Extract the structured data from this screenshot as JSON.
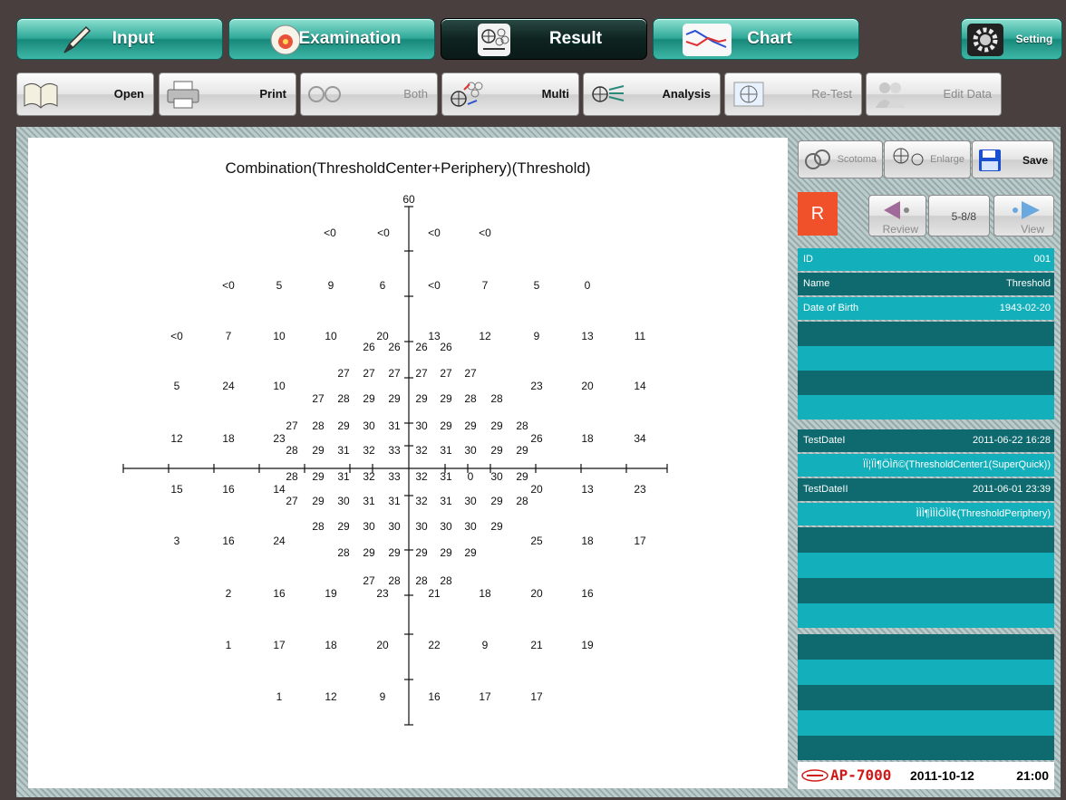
{
  "nav": {
    "tabs": [
      {
        "label": "Input",
        "icon": "pen-icon"
      },
      {
        "label": "Examination",
        "icon": "eye-target-icon"
      },
      {
        "label": "Result",
        "icon": "result-grid-icon"
      },
      {
        "label": "Chart",
        "icon": "chart-line-icon"
      }
    ],
    "setting": "Setting"
  },
  "toolbar": {
    "open": "Open",
    "print": "Print",
    "both": "Both",
    "multi": "Multi",
    "analysis": "Analysis",
    "retest": "Re-Test",
    "edit_data": "Edit Data"
  },
  "side": {
    "scotoma": "Scotoma",
    "enlarge": "Enlarge",
    "save": "Save",
    "eye": "R",
    "review": "Review",
    "page": "5-8/8",
    "view": "View"
  },
  "patient": {
    "id_label": "ID",
    "id_value": "001",
    "name_label": "Name",
    "name_value": "Threshold",
    "dob_label": "Date of Birth",
    "dob_value": "1943-02-20"
  },
  "tests": {
    "t1_label": "TestDateI",
    "t1_value": "2011-06-22 16:28",
    "t1_program": "ÏÏ¦ÏÌ¶ÖÌñ©(ThresholdCenter1(SuperQuick))",
    "t2_label": "TestDateII",
    "t2_value": "2011-06-01 23:39",
    "t2_program": "ÌÌÌ¶ÌÌÌÖÌÌ¢(ThresholdPeriphery)"
  },
  "status": {
    "brand": "AP-7000",
    "date": "2011-10-12",
    "time": "21:00"
  },
  "plot": {
    "title": "Combination(ThresholdCenter+Periphery)(Threshold)",
    "axis_top": "60",
    "values": [
      [
        "<0",
        364,
        257
      ],
      [
        "<0",
        423,
        257
      ],
      [
        "<0",
        479,
        257
      ],
      [
        "<0",
        535,
        257
      ],
      [
        "<0",
        252,
        315
      ],
      [
        "5",
        308,
        315
      ],
      [
        "9",
        365,
        315
      ],
      [
        "6",
        422,
        315
      ],
      [
        "<0",
        479,
        315
      ],
      [
        "7",
        535,
        315
      ],
      [
        "5",
        592,
        315
      ],
      [
        "0",
        648,
        315
      ],
      [
        "<0",
        195,
        371
      ],
      [
        "7",
        252,
        371
      ],
      [
        "10",
        308,
        371
      ],
      [
        "10",
        365,
        371
      ],
      [
        "20",
        422,
        371
      ],
      [
        "13",
        479,
        371
      ],
      [
        "12",
        535,
        371
      ],
      [
        "9",
        592,
        371
      ],
      [
        "13",
        648,
        371
      ],
      [
        "11",
        706,
        371
      ],
      [
        "26",
        407,
        383
      ],
      [
        "26",
        435,
        383
      ],
      [
        "26",
        465,
        383
      ],
      [
        "26",
        492,
        383
      ],
      [
        "27",
        379,
        412
      ],
      [
        "27",
        407,
        412
      ],
      [
        "27",
        435,
        412
      ],
      [
        "27",
        465,
        412
      ],
      [
        "27",
        492,
        412
      ],
      [
        "27",
        519,
        412
      ],
      [
        "5",
        195,
        426
      ],
      [
        "24",
        252,
        426
      ],
      [
        "10",
        308,
        426
      ],
      [
        "23",
        592,
        426
      ],
      [
        "20",
        648,
        426
      ],
      [
        "14",
        706,
        426
      ],
      [
        "27",
        351,
        440
      ],
      [
        "28",
        379,
        440
      ],
      [
        "29",
        407,
        440
      ],
      [
        "29",
        435,
        440
      ],
      [
        "29",
        465,
        440
      ],
      [
        "29",
        492,
        440
      ],
      [
        "28",
        519,
        440
      ],
      [
        "28",
        548,
        440
      ],
      [
        "27",
        322,
        470
      ],
      [
        "28",
        351,
        470
      ],
      [
        "29",
        379,
        470
      ],
      [
        "30",
        407,
        470
      ],
      [
        "31",
        435,
        470
      ],
      [
        "30",
        465,
        470
      ],
      [
        "29",
        492,
        470
      ],
      [
        "29",
        519,
        470
      ],
      [
        "29",
        548,
        470
      ],
      [
        "28",
        576,
        470
      ],
      [
        "12",
        195,
        484
      ],
      [
        "18",
        252,
        484
      ],
      [
        "23",
        308,
        484
      ],
      [
        "26",
        592,
        484
      ],
      [
        "18",
        648,
        484
      ],
      [
        "34",
        706,
        484
      ],
      [
        "28",
        322,
        497
      ],
      [
        "29",
        351,
        497
      ],
      [
        "31",
        379,
        497
      ],
      [
        "32",
        407,
        497
      ],
      [
        "33",
        435,
        497
      ],
      [
        "32",
        465,
        497
      ],
      [
        "31",
        492,
        497
      ],
      [
        "30",
        519,
        497
      ],
      [
        "29",
        548,
        497
      ],
      [
        "29",
        576,
        497
      ],
      [
        "28",
        322,
        526
      ],
      [
        "29",
        351,
        526
      ],
      [
        "31",
        379,
        526
      ],
      [
        "32",
        407,
        526
      ],
      [
        "33",
        435,
        526
      ],
      [
        "32",
        465,
        526
      ],
      [
        "31",
        492,
        526
      ],
      [
        "0",
        519,
        526
      ],
      [
        "30",
        548,
        526
      ],
      [
        "29",
        576,
        526
      ],
      [
        "15",
        195,
        540
      ],
      [
        "16",
        252,
        540
      ],
      [
        "14",
        308,
        540
      ],
      [
        "20",
        592,
        540
      ],
      [
        "13",
        648,
        540
      ],
      [
        "23",
        706,
        540
      ],
      [
        "27",
        322,
        553
      ],
      [
        "29",
        351,
        553
      ],
      [
        "30",
        379,
        553
      ],
      [
        "31",
        407,
        553
      ],
      [
        "31",
        435,
        553
      ],
      [
        "32",
        465,
        553
      ],
      [
        "31",
        492,
        553
      ],
      [
        "30",
        519,
        553
      ],
      [
        "29",
        548,
        553
      ],
      [
        "28",
        576,
        553
      ],
      [
        "28",
        351,
        581
      ],
      [
        "29",
        379,
        581
      ],
      [
        "30",
        407,
        581
      ],
      [
        "30",
        435,
        581
      ],
      [
        "30",
        465,
        581
      ],
      [
        "30",
        492,
        581
      ],
      [
        "30",
        519,
        581
      ],
      [
        "29",
        548,
        581
      ],
      [
        "3",
        195,
        597
      ],
      [
        "16",
        252,
        597
      ],
      [
        "24",
        308,
        597
      ],
      [
        "25",
        592,
        597
      ],
      [
        "18",
        648,
        597
      ],
      [
        "17",
        706,
        597
      ],
      [
        "28",
        379,
        610
      ],
      [
        "29",
        407,
        610
      ],
      [
        "29",
        435,
        610
      ],
      [
        "29",
        465,
        610
      ],
      [
        "29",
        492,
        610
      ],
      [
        "29",
        519,
        610
      ],
      [
        "27",
        407,
        641
      ],
      [
        "28",
        435,
        641
      ],
      [
        "28",
        465,
        641
      ],
      [
        "28",
        492,
        641
      ],
      [
        "2",
        252,
        655
      ],
      [
        "16",
        308,
        655
      ],
      [
        "19",
        365,
        655
      ],
      [
        "23",
        422,
        655
      ],
      [
        "21",
        479,
        655
      ],
      [
        "18",
        535,
        655
      ],
      [
        "20",
        592,
        655
      ],
      [
        "16",
        648,
        655
      ],
      [
        "1",
        252,
        712
      ],
      [
        "17",
        308,
        712
      ],
      [
        "18",
        365,
        712
      ],
      [
        "20",
        422,
        712
      ],
      [
        "22",
        479,
        712
      ],
      [
        "9",
        535,
        712
      ],
      [
        "21",
        592,
        712
      ],
      [
        "19",
        648,
        712
      ],
      [
        "1",
        308,
        769
      ],
      [
        "12",
        365,
        769
      ],
      [
        "9",
        422,
        769
      ],
      [
        "16",
        479,
        769
      ],
      [
        "17",
        535,
        769
      ],
      [
        "17",
        592,
        769
      ]
    ]
  }
}
